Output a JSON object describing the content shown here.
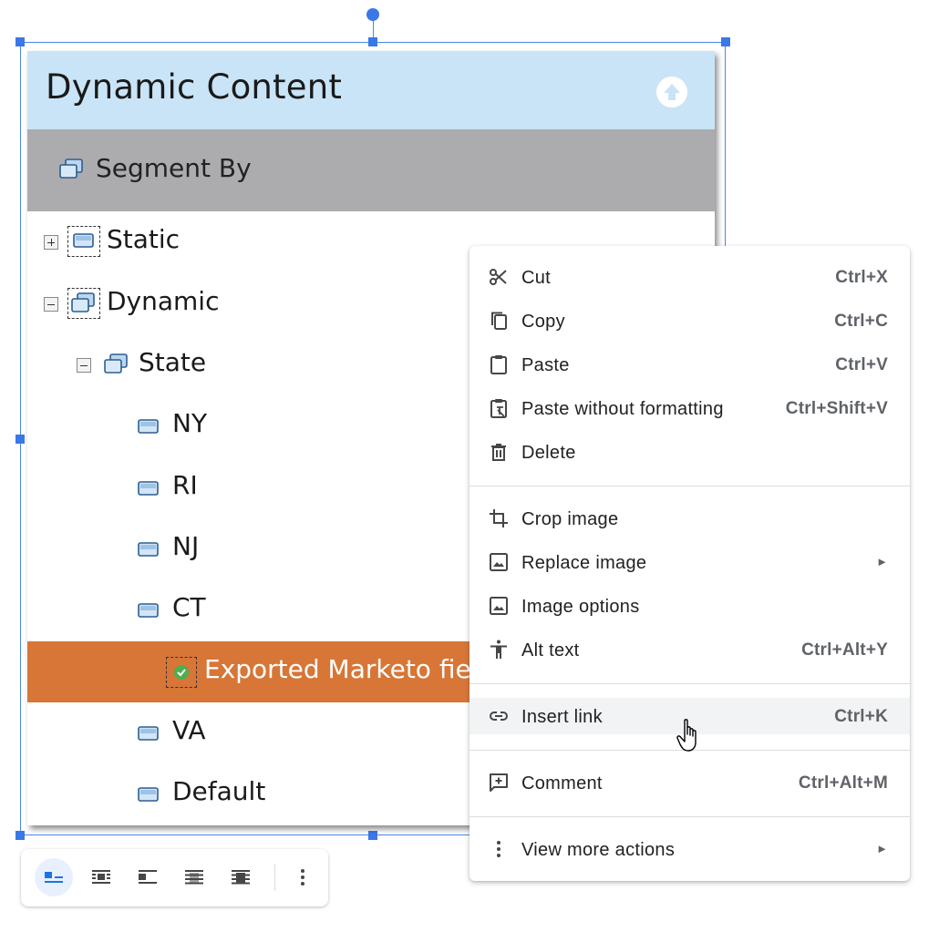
{
  "image": {
    "title": "Dynamic Content",
    "segment_by": "Segment By",
    "tree": [
      {
        "label": "Static",
        "level": 0,
        "expander": "plus"
      },
      {
        "label": "Dynamic",
        "level": 0,
        "expander": "minus"
      },
      {
        "label": "State",
        "level": 1,
        "expander": "minus"
      },
      {
        "label": "NY",
        "level": 2
      },
      {
        "label": "RI",
        "level": 2
      },
      {
        "label": "NJ",
        "level": 2
      },
      {
        "label": "CT",
        "level": 2
      },
      {
        "label": "Exported Marketo fiel",
        "level": 3,
        "selected": true
      },
      {
        "label": "VA",
        "level": 2
      },
      {
        "label": "Default",
        "level": 2
      }
    ],
    "colors": {
      "header_bg": "#c9e4f6",
      "segment_bg": "#acabae",
      "selected_bg": "#d77636"
    }
  },
  "context_menu": {
    "groups": [
      [
        {
          "icon": "scissors-icon",
          "label": "Cut",
          "shortcut": "Ctrl+X"
        },
        {
          "icon": "copy-icon",
          "label": "Copy",
          "shortcut": "Ctrl+C"
        },
        {
          "icon": "clipboard-icon",
          "label": "Paste",
          "shortcut": "Ctrl+V"
        },
        {
          "icon": "paste-plain-icon",
          "label": "Paste without formatting",
          "shortcut": "Ctrl+Shift+V"
        },
        {
          "icon": "trash-icon",
          "label": "Delete",
          "shortcut": ""
        }
      ],
      [
        {
          "icon": "crop-icon",
          "label": "Crop image",
          "shortcut": ""
        },
        {
          "icon": "image-icon",
          "label": "Replace image",
          "shortcut": "",
          "submenu": true
        },
        {
          "icon": "image-icon",
          "label": "Image options",
          "shortcut": ""
        },
        {
          "icon": "accessibility-icon",
          "label": "Alt text",
          "shortcut": "Ctrl+Alt+Y"
        }
      ],
      [
        {
          "icon": "link-icon",
          "label": "Insert link",
          "shortcut": "Ctrl+K",
          "hover": true
        }
      ],
      [
        {
          "icon": "comment-add-icon",
          "label": "Comment",
          "shortcut": "Ctrl+Alt+M"
        }
      ],
      [
        {
          "icon": "more-vert-icon",
          "label": "View more actions",
          "shortcut": "",
          "submenu": true
        }
      ]
    ],
    "submenu_arrow": "►"
  },
  "toolbar": {
    "buttons": [
      {
        "icon": "wrap-inline-icon",
        "active": true
      },
      {
        "icon": "wrap-text-icon"
      },
      {
        "icon": "break-text-icon"
      },
      {
        "icon": "behind-text-icon"
      },
      {
        "icon": "in-front-of-text-icon"
      }
    ],
    "more_icon": "more-vert-icon",
    "accent": "#1a73e8"
  }
}
